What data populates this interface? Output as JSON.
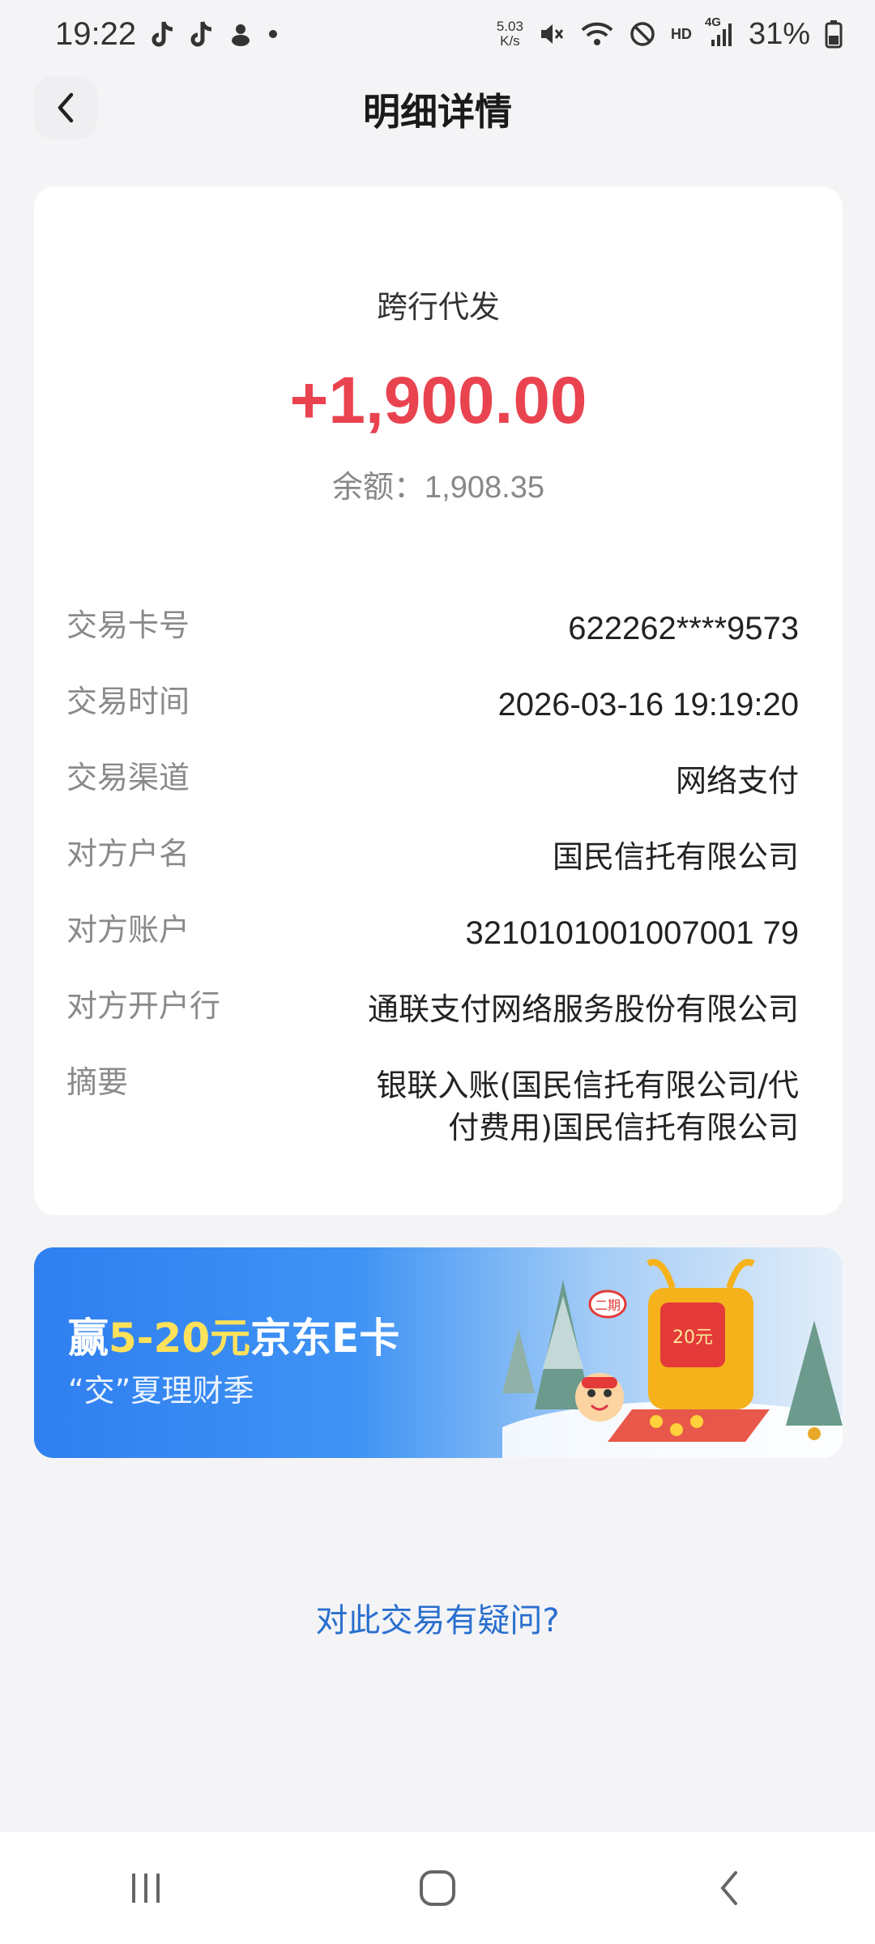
{
  "status_bar": {
    "time": "19:22",
    "net_speed_value": "5.03",
    "net_speed_unit": "K/s",
    "hd_label": "HD",
    "signal_label": "4G",
    "battery": "31%",
    "icons": [
      "tiktok-icon",
      "tiktok-icon",
      "notification-icon",
      "dot-icon",
      "mute-icon",
      "wifi-icon",
      "dnd-icon",
      "signal-icon",
      "battery-icon"
    ]
  },
  "header": {
    "title": "明细详情"
  },
  "transaction": {
    "type": "跨行代发",
    "amount": "+1,900.00",
    "balance_label": "余额：",
    "balance_value": "1,908.35",
    "amount_color": "#e9434f",
    "details": [
      {
        "label": "交易卡号",
        "value": "622262****9573"
      },
      {
        "label": "交易时间",
        "value": "2026-03-16 19:19:20"
      },
      {
        "label": "交易渠道",
        "value": "网络支付"
      },
      {
        "label": "对方户名",
        "value": "国民信托有限公司"
      },
      {
        "label": "对方账户",
        "value": "3210101001007001 79"
      },
      {
        "label": "对方开户行",
        "value": "通联支付网络服务股份有限公司"
      },
      {
        "label": "摘要",
        "value": "银联入账(国民信托有限公司/代付费用)国民信托有限公司"
      }
    ]
  },
  "banner": {
    "prefix": "赢",
    "highlight": "5-20元",
    "suffix": "京东E卡",
    "subtitle": "“交”夏理财季",
    "badge_text": "20元",
    "tag_text": "二期"
  },
  "footer": {
    "question_link": "对此交易有疑问?"
  },
  "colors": {
    "accent_blue": "#2a6fcf",
    "amount_red": "#e9434f"
  }
}
